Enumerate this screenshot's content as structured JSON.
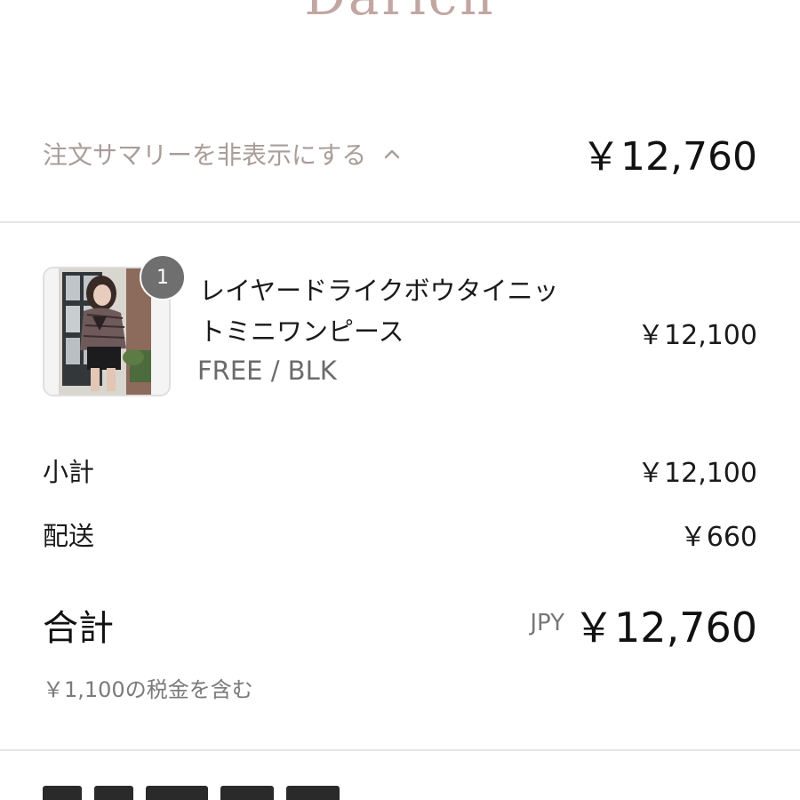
{
  "header": {
    "brand": "Darich"
  },
  "summary_bar": {
    "toggle_label": "注文サマリーを非表示にする",
    "toggle_icon": "chevron-up-icon",
    "total": "￥12,760"
  },
  "line_item": {
    "quantity": "1",
    "name_line1": "レイヤードライクボウタイニッ",
    "name_line2": "トミニワンピース",
    "variant": "FREE / BLK",
    "price": "￥12,100"
  },
  "totals": {
    "subtotal_label": "小計",
    "subtotal_value": "￥12,100",
    "shipping_label": "配送",
    "shipping_value": "￥660",
    "total_label": "合計",
    "currency": "JPY",
    "total_value": "￥12,760",
    "tax_note": "￥1,100の税金を含む"
  },
  "colors": {
    "brand": "#c2a6a2",
    "muted_text": "#a99d98",
    "badge": "#6f6f6f",
    "divider": "#e4e4e4"
  }
}
